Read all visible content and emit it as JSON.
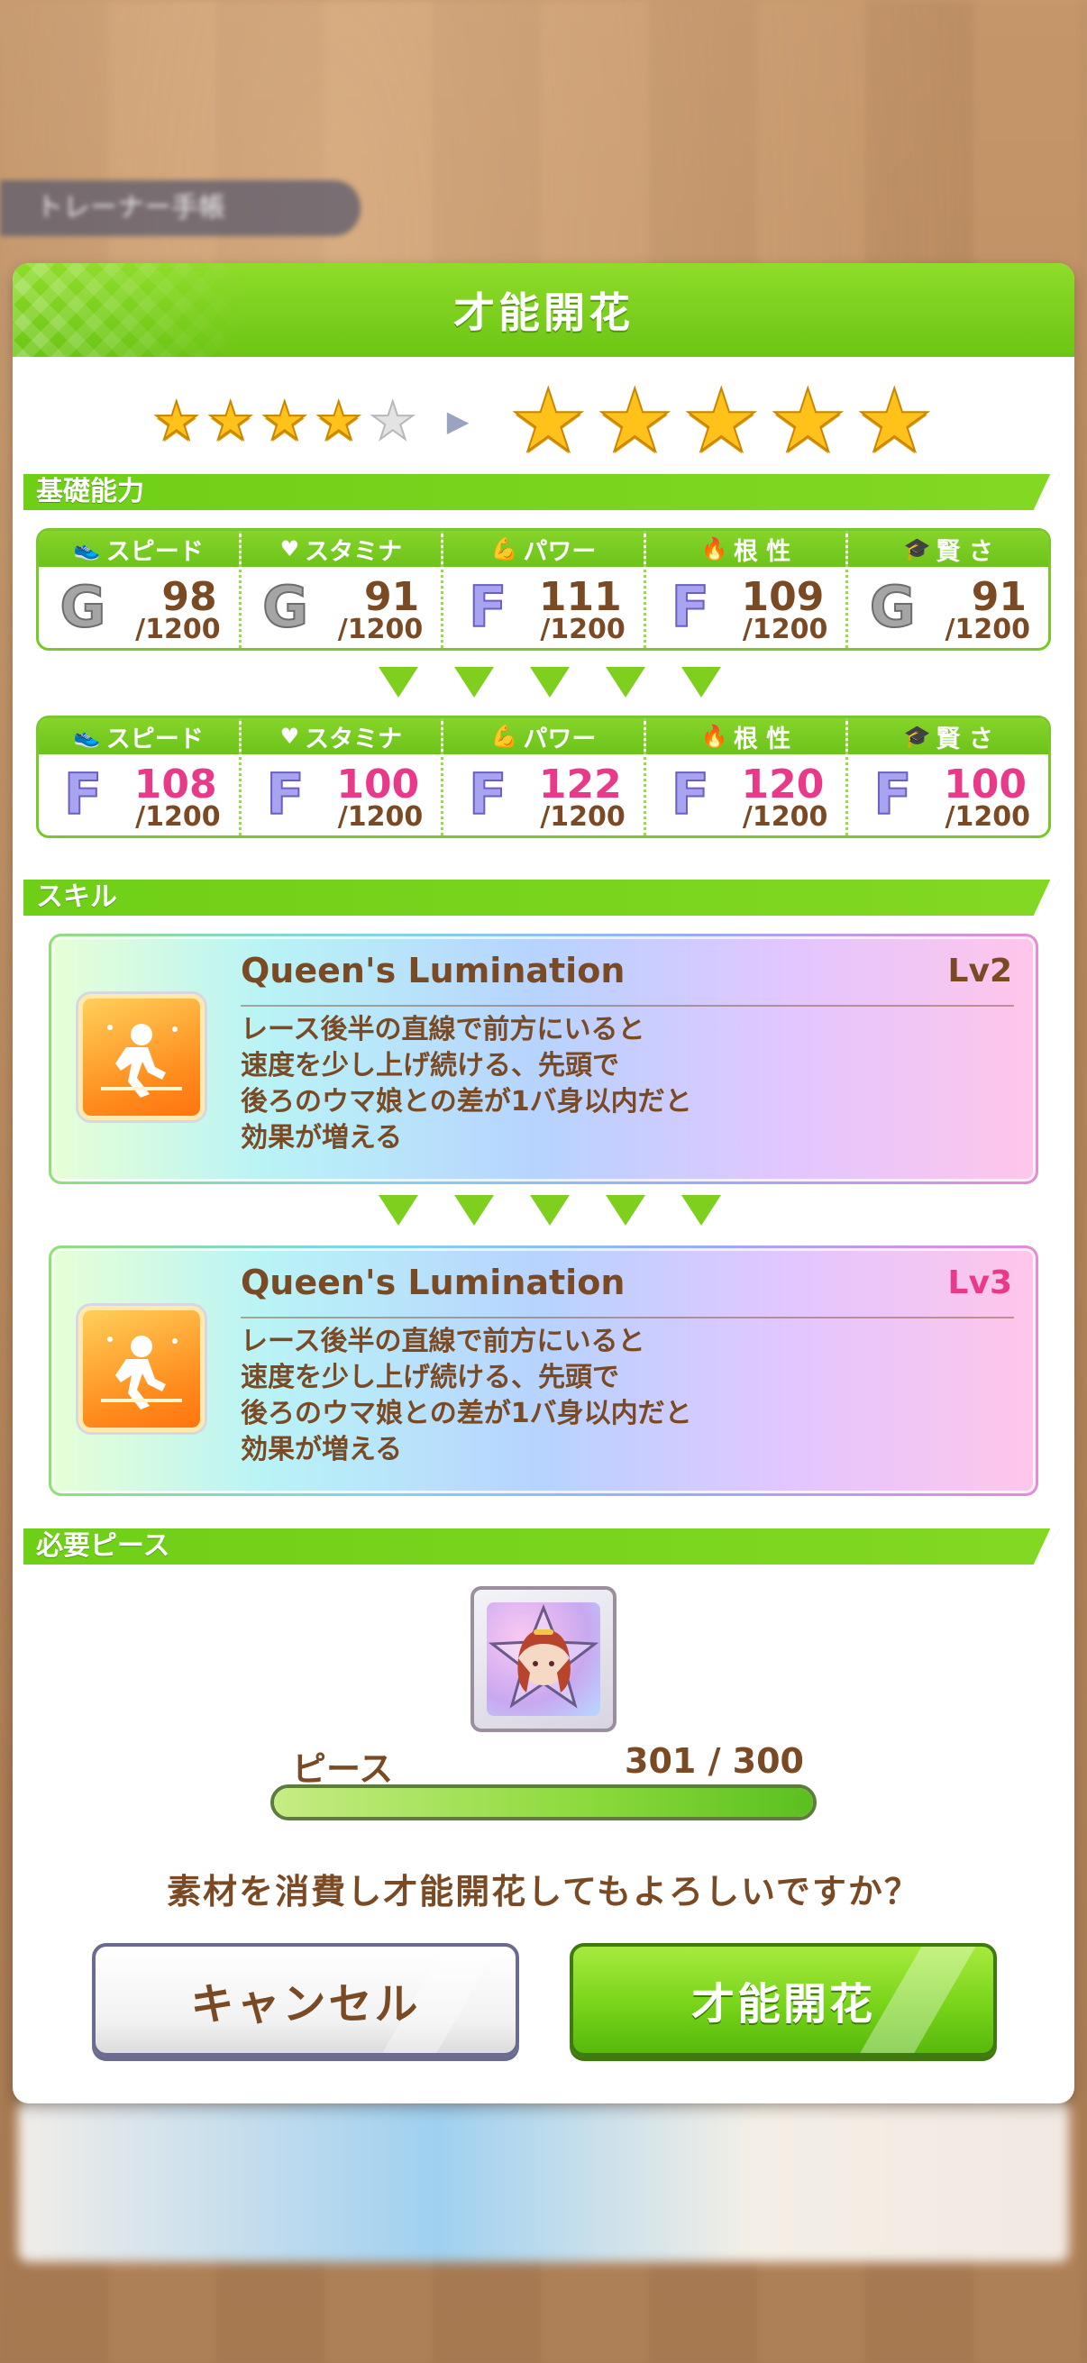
{
  "background": {
    "tag_label": "トレーナー手帳"
  },
  "dialog": {
    "title": "才能開花",
    "stars_before": 4,
    "stars_before_total": 5,
    "stars_after": 5
  },
  "sections": {
    "base_stats": "基礎能力",
    "skill": "スキル",
    "pieces": "必要ピース"
  },
  "stats_before": [
    {
      "label": "スピード",
      "icon": "shoe-icon",
      "rank": "G",
      "value": "98",
      "max": "/1200"
    },
    {
      "label": "スタミナ",
      "icon": "heart-icon",
      "rank": "G",
      "value": "91",
      "max": "/1200"
    },
    {
      "label": "パワー",
      "icon": "muscle-icon",
      "rank": "F",
      "value": "111",
      "max": "/1200"
    },
    {
      "label": "根 性",
      "icon": "flame-icon",
      "rank": "F",
      "value": "109",
      "max": "/1200"
    },
    {
      "label": "賢 さ",
      "icon": "graduation-cap-icon",
      "rank": "G",
      "value": "91",
      "max": "/1200"
    }
  ],
  "stats_after": [
    {
      "label": "スピード",
      "icon": "shoe-icon",
      "rank": "F",
      "value": "108",
      "max": "/1200"
    },
    {
      "label": "スタミナ",
      "icon": "heart-icon",
      "rank": "F",
      "value": "100",
      "max": "/1200"
    },
    {
      "label": "パワー",
      "icon": "muscle-icon",
      "rank": "F",
      "value": "122",
      "max": "/1200"
    },
    {
      "label": "根 性",
      "icon": "flame-icon",
      "rank": "F",
      "value": "120",
      "max": "/1200"
    },
    {
      "label": "賢 さ",
      "icon": "graduation-cap-icon",
      "rank": "F",
      "value": "100",
      "max": "/1200"
    }
  ],
  "skill_before": {
    "name": "Queen's Lumination",
    "level": "Lv2",
    "description": [
      "レース後半の直線で前方にいると",
      "速度を少し上げ続ける、先頭で",
      "後ろのウマ娘との差が1バ身以内だと",
      "効果が増える"
    ]
  },
  "skill_after": {
    "name": "Queen's Lumination",
    "level": "Lv3",
    "description": [
      "レース後半の直線で前方にいると",
      "速度を少し上げ続ける、先頭で",
      "後ろのウマ娘との差が1バ身以内だと",
      "効果が増える"
    ]
  },
  "pieces": {
    "label": "ピース",
    "count": "301 / 300",
    "progress": 1.0
  },
  "confirm_text": "素材を消費し才能開花してもよろしいですか？",
  "buttons": {
    "cancel": "キャンセル",
    "confirm": "才能開花"
  },
  "colors": {
    "accent_green": "#6cc514",
    "text_brown": "#7a4a25",
    "increase_pink": "#e83a88",
    "star_gold": "#ffc21a"
  }
}
